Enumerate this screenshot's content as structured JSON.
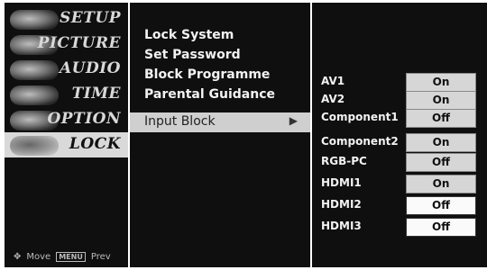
{
  "categories": [
    {
      "label": "SETUP",
      "icon": "satellite-dish-icon"
    },
    {
      "label": "PICTURE",
      "icon": "picture-icon"
    },
    {
      "label": "AUDIO",
      "icon": "audio-icon"
    },
    {
      "label": "TIME",
      "icon": "clock-icon"
    },
    {
      "label": "OPTION",
      "icon": "option-icon"
    },
    {
      "label": "LOCK",
      "icon": "lock-icon",
      "selected": true
    }
  ],
  "footer": {
    "move_label": "Move",
    "menu_key": "MENU",
    "prev_label": "Prev"
  },
  "submenu": [
    {
      "label": "Lock System"
    },
    {
      "label": "Set Password"
    },
    {
      "label": "Block Programme"
    },
    {
      "label": "Parental Guidance"
    },
    {
      "label": "Input Block",
      "selected": true
    }
  ],
  "inputs": [
    {
      "name": "AV1",
      "value": "On"
    },
    {
      "name": "AV2",
      "value": "On"
    },
    {
      "name": "Component1",
      "value": "Off"
    },
    {
      "name": "Component2",
      "value": "On"
    },
    {
      "name": "RGB-PC",
      "value": "Off"
    },
    {
      "name": "HDMI1",
      "value": "On"
    },
    {
      "name": "HDMI2",
      "value": "Off"
    },
    {
      "name": "HDMI3",
      "value": "Off"
    }
  ],
  "colors": {
    "panel_bg": "#0f0f0f",
    "highlight": "#d9d9d9",
    "text": "#f2f2f2"
  }
}
